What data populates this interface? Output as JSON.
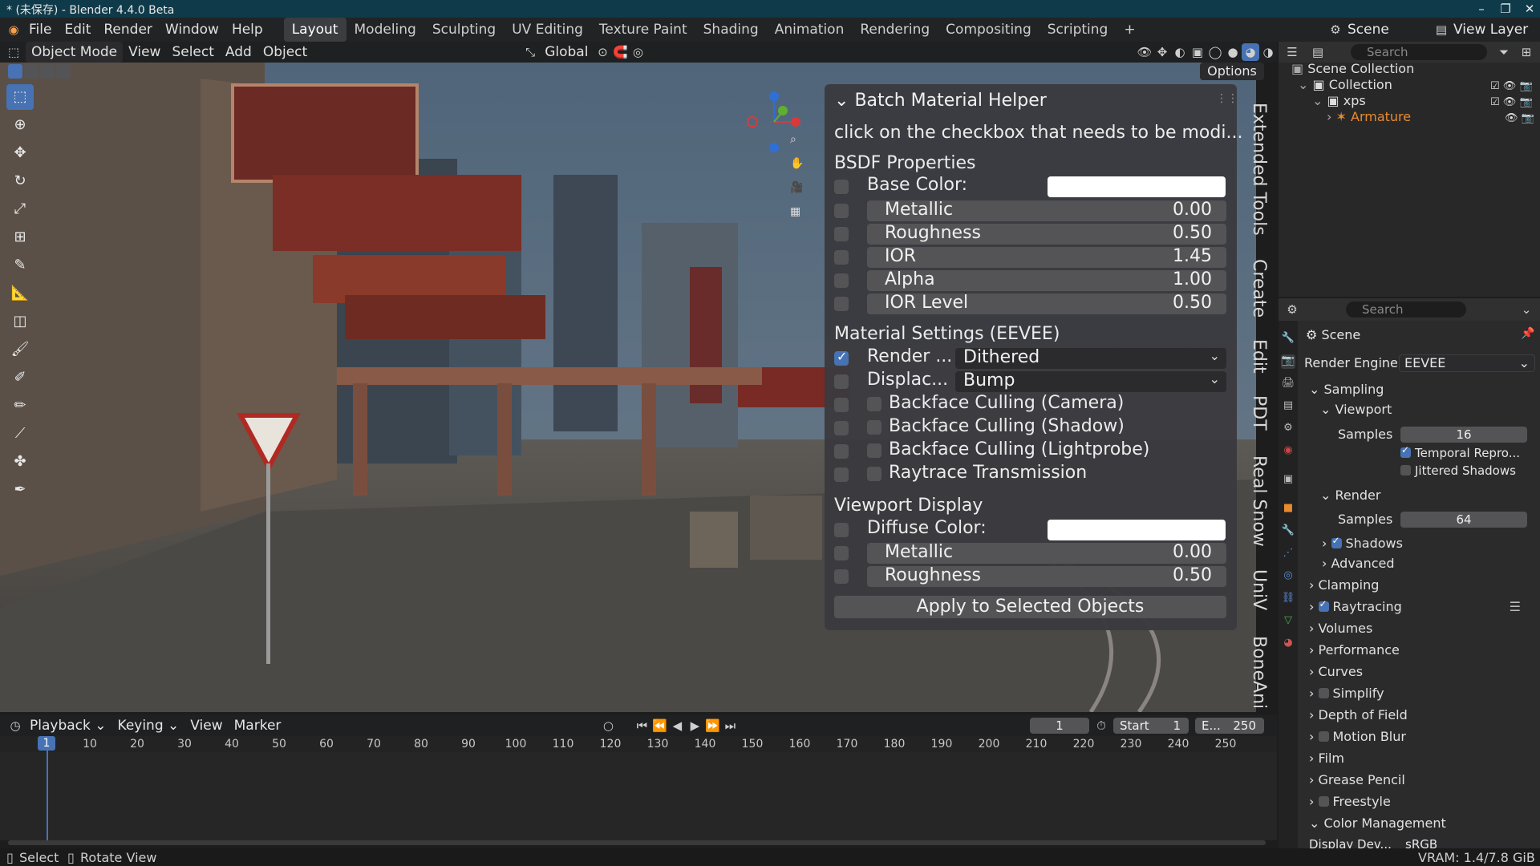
{
  "window": {
    "title": "* (未保存) - Blender 4.4.0 Beta"
  },
  "menu": [
    "File",
    "Edit",
    "Render",
    "Window",
    "Help"
  ],
  "workspaces": [
    "Layout",
    "Modeling",
    "Sculpting",
    "UV Editing",
    "Texture Paint",
    "Shading",
    "Animation",
    "Rendering",
    "Compositing",
    "Scripting"
  ],
  "topright": {
    "scene": "Scene",
    "view_layer": "View Layer"
  },
  "viewport_header": {
    "mode": "Object Mode",
    "view": "View",
    "select": "Select",
    "add": "Add",
    "object": "Object",
    "orientation": "Global",
    "options": "Options"
  },
  "panel": {
    "title": "Batch Material Helper",
    "hint": "click on the checkbox that needs to be modi...",
    "bsdf_heading": "BSDF Properties",
    "base_color_label": "Base Color:",
    "bsdf": [
      {
        "label": "Metallic",
        "value": "0.00"
      },
      {
        "label": "Roughness",
        "value": "0.50"
      },
      {
        "label": "IOR",
        "value": "1.45"
      },
      {
        "label": "Alpha",
        "value": "1.00"
      },
      {
        "label": "IOR Level",
        "value": "0.50"
      }
    ],
    "material_heading": "Material Settings  (EEVEE)",
    "render_label": "Render ...",
    "render_value": "Dithered",
    "displace_label": "Displac...",
    "displace_value": "Bump",
    "toggles": [
      "Backface Culling (Camera)",
      "Backface Culling (Shadow)",
      "Backface Culling (Lightprobe)",
      "Raytrace Transmission"
    ],
    "viewport_heading": "Viewport Display",
    "diffuse_label": "Diffuse Color:",
    "viewport": [
      {
        "label": "Metallic",
        "value": "0.00"
      },
      {
        "label": "Roughness",
        "value": "0.50"
      }
    ],
    "apply_button": "Apply to Selected Objects"
  },
  "side_tabs": [
    "Extended Tools",
    "Create",
    "Edit",
    "PDT",
    "Real Snow",
    "UniV",
    "BoneAni"
  ],
  "timeline": {
    "playback": "Playback",
    "keying": "Keying",
    "view": "View",
    "marker": "Marker",
    "current_frame": "1",
    "start_label": "Start",
    "start": "1",
    "end_label": "E...",
    "end": "250",
    "ticks": [
      "1",
      "10",
      "20",
      "30",
      "40",
      "50",
      "60",
      "70",
      "80",
      "90",
      "100",
      "110",
      "120",
      "130",
      "140",
      "150",
      "160",
      "170",
      "180",
      "190",
      "200",
      "210",
      "220",
      "230",
      "240",
      "250"
    ]
  },
  "statusbar": {
    "select": "Select",
    "rotate": "Rotate View",
    "vram": "VRAM: 1.4/7.8 GiB"
  },
  "outliner": {
    "search_placeholder": "Search",
    "items": [
      {
        "label": "Scene Collection"
      },
      {
        "label": "Collection"
      },
      {
        "label": "xps"
      },
      {
        "label": "Armature"
      }
    ]
  },
  "properties": {
    "search_placeholder": "Search",
    "scene": "Scene",
    "render_engine_label": "Render Engine",
    "render_engine": "EEVEE",
    "sampling": "Sampling",
    "viewport": "Viewport",
    "samples_label": "Samples",
    "viewport_samples": "16",
    "temporal": "Temporal Repro...",
    "jittered": "Jittered Shadows",
    "render": "Render",
    "render_samples": "64",
    "shadows": "Shadows",
    "advanced": "Advanced",
    "sections": [
      "Clamping",
      "Raytracing",
      "Volumes",
      "Performance",
      "Curves",
      "Simplify",
      "Depth of Field",
      "Motion Blur",
      "Film",
      "Grease Pencil",
      "Freestyle",
      "Color Management"
    ],
    "display_device_label": "Display Dev...",
    "display_device": "sRGB"
  },
  "colors": {
    "accent": "#4772b3",
    "armature": "#e88b2e"
  }
}
